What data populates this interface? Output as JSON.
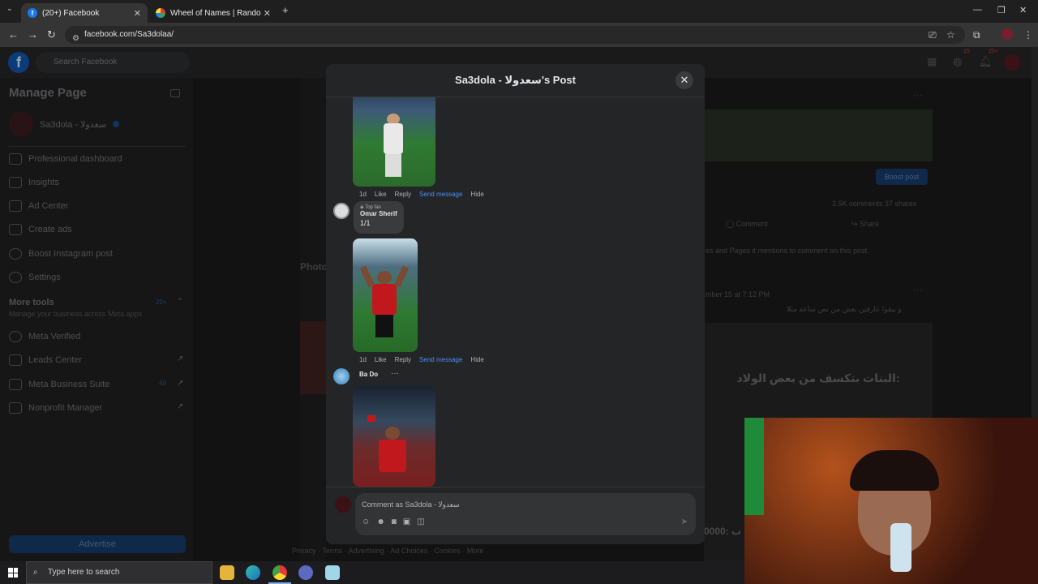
{
  "browser": {
    "tabs": [
      {
        "label": "(20+) Facebook",
        "active": true
      },
      {
        "label": "Wheel of Names | Random nam",
        "active": false
      }
    ],
    "url": "facebook.com/Sa3dolaa/",
    "new_tab": "+"
  },
  "facebook": {
    "search_placeholder": "Search Facebook",
    "sidebar": {
      "title": "Manage Page",
      "page_name": "Sa3dola - سعدولا",
      "items": [
        {
          "label": "Professional dashboard"
        },
        {
          "label": "Insights"
        },
        {
          "label": "Ad Center"
        },
        {
          "label": "Create ads"
        },
        {
          "label": "Boost Instagram post"
        },
        {
          "label": "Settings"
        }
      ],
      "more_tools": "More tools",
      "more_tools_badge": "20+",
      "more_tools_sub": "Manage your business across Meta apps",
      "tools": [
        {
          "label": "Meta Verified"
        },
        {
          "label": "Leads Center"
        },
        {
          "label": "Meta Business Suite",
          "badge": "40"
        },
        {
          "label": "Nonprofit Manager"
        }
      ],
      "advertise": "Advertise"
    },
    "background": {
      "photos_label": "Photo",
      "boost_post": "Boost post",
      "stats": "3.5K comments   37 shares",
      "comment": "Comment",
      "share": "Share",
      "mention_note": "es and Pages it mentions to comment on this post.",
      "post_date": "mber 15 at 7:12 PM",
      "post_text_ar": "و بيقوا عارفين بعض من نص ساعة مثلا",
      "image_text_ar": "البنات بتكسف من بعض الولاد:",
      "footer": "Privacy · Terms · Advertising · Ad Choices · Cookies · More",
      "image_text_bottom": "0000:  ب"
    },
    "notifications": {
      "messenger_badge": "15",
      "bell_badge": "20+"
    }
  },
  "modal": {
    "title": "Sa3dola - سعدولا's Post",
    "comments": [
      {
        "name": "",
        "text": "",
        "time": "1d",
        "actions": [
          "Like",
          "Reply",
          "Send message",
          "Hide"
        ]
      },
      {
        "badge": "Top fan",
        "name": "Omar Sherif",
        "text": "1/1",
        "time": "1d",
        "actions": [
          "Like",
          "Reply",
          "Send message",
          "Hide"
        ]
      },
      {
        "name": "Ba Do",
        "more": "···"
      }
    ],
    "comment_box": {
      "placeholder": "Comment as Sa3dola - سعدولا"
    }
  },
  "taskbar": {
    "search_placeholder": "Type here to search"
  }
}
